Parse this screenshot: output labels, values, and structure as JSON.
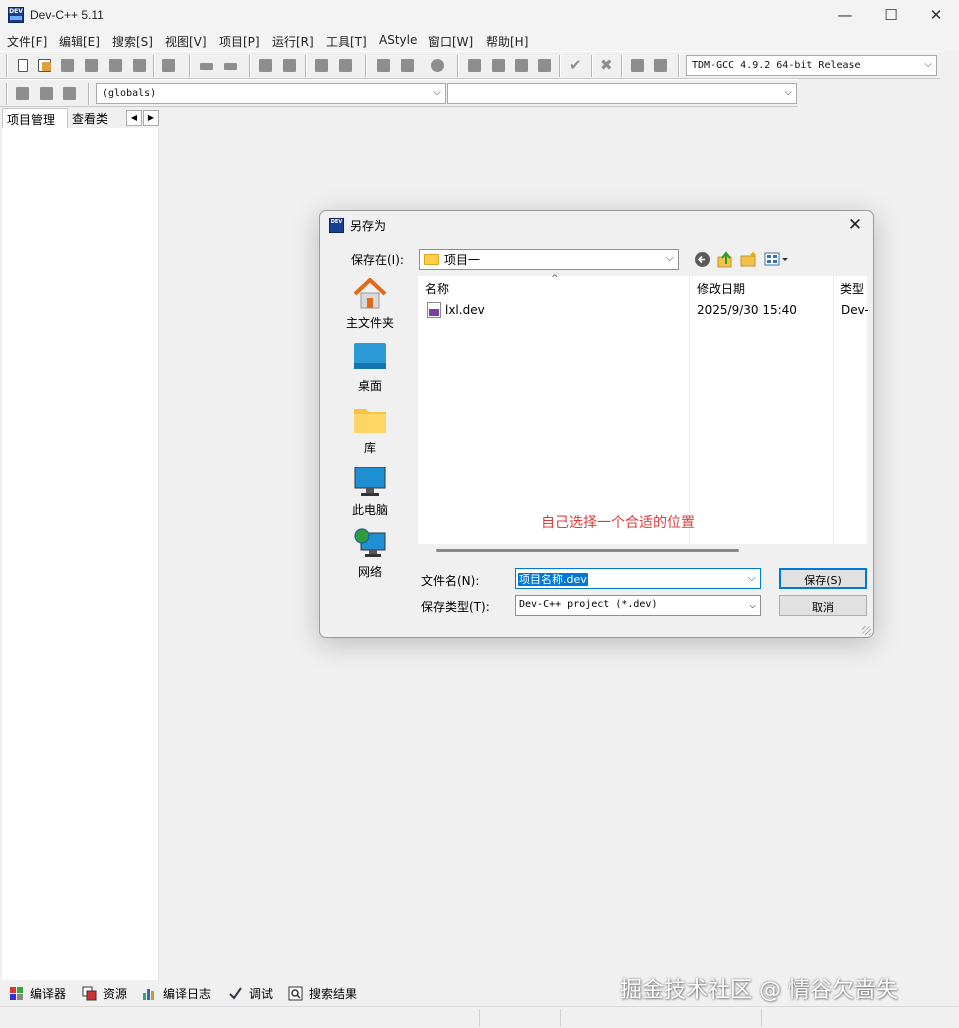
{
  "window": {
    "title": "Dev-C++ 5.11",
    "app_icon_text": "DEV",
    "minimize_glyph": "—",
    "maximize_glyph": "☐",
    "close_glyph": "✕"
  },
  "menubar": [
    "文件[F]",
    "编辑[E]",
    "搜索[S]",
    "视图[V]",
    "项目[P]",
    "运行[R]",
    "工具[T]",
    "AStyle",
    "窗口[W]",
    "帮助[H]"
  ],
  "toolbar": {
    "compiler_select": "TDM-GCC 4.9.2 64-bit Release",
    "globals_select": "(globals)",
    "second_select": "",
    "dropdown_arrow": "⌵"
  },
  "left_panel": {
    "tabs": [
      "项目管理",
      "查看类"
    ],
    "scroll_left": "◀",
    "scroll_right": "▶"
  },
  "bottom_tabs": [
    "编译器",
    "资源",
    "编译日志",
    "调试",
    "搜索结果"
  ],
  "watermark": "掘金技术社区 @ 情谷欠啬失",
  "dialog": {
    "title": "另存为",
    "close_glyph": "✕",
    "save_in_label": "保存在(I):",
    "current_folder": "项目一",
    "places": [
      "主文件夹",
      "桌面",
      "库",
      "此电脑",
      "网络"
    ],
    "columns": {
      "name": "名称",
      "modified": "修改日期",
      "type": "类型"
    },
    "sort_caret": "^",
    "files": [
      {
        "name": "lxl.dev",
        "modified": "2025/9/30 15:40",
        "type": "Dev-"
      }
    ],
    "annotation": "自己选择一个合适的位置",
    "filename_label": "文件名(N):",
    "filename_value": "项目名称.dev",
    "filetype_label": "保存类型(T):",
    "filetype_value": "Dev-C++ project (*.dev)",
    "save_button": "保存(S)",
    "cancel_button": "取消"
  },
  "colors": {
    "accent": "#0078d7",
    "annotation": "#e23b3b",
    "folder": "#ffce4a"
  }
}
